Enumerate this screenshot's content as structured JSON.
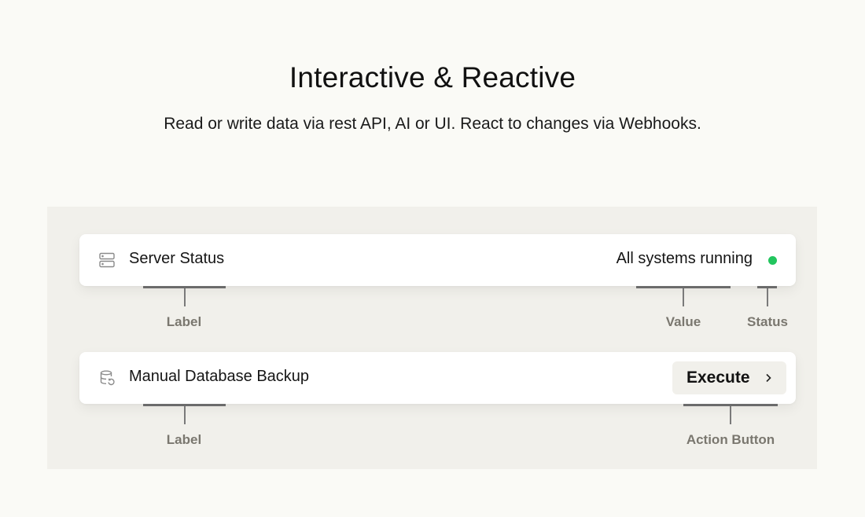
{
  "header": {
    "title": "Interactive & Reactive",
    "subtitle": "Read or write data via rest API, AI or UI. React to changes via Webhooks."
  },
  "cards": {
    "server_status": {
      "icon": "server-icon",
      "label": "Server Status",
      "value": "All systems running",
      "status_color": "#22c55e"
    },
    "backup": {
      "icon": "database-backup-icon",
      "label": "Manual Database Backup",
      "button_label": "Execute",
      "button_icon": "chevron-right-icon"
    }
  },
  "annotations": {
    "row1": {
      "label": "Label",
      "value": "Value",
      "status": "Status"
    },
    "row2": {
      "label": "Label",
      "action": "Action Button"
    }
  }
}
